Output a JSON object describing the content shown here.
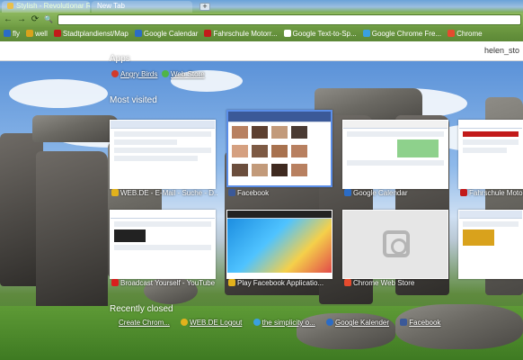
{
  "tabs": [
    {
      "label": "Stylish - Revolutionar Rate",
      "active": false
    },
    {
      "label": "New Tab",
      "active": true
    }
  ],
  "newtab_glyph": "+",
  "toolbar": {
    "back": "←",
    "forward": "→",
    "reload": "⟳",
    "search": "🔍"
  },
  "bookmarks": [
    {
      "label": "fly",
      "color": "#2b6cc6"
    },
    {
      "label": "well",
      "color": "#d9a21c"
    },
    {
      "label": "Stadtplandienst/Map",
      "color": "#c21a1a"
    },
    {
      "label": "Google Calendar",
      "color": "#2b6cc6"
    },
    {
      "label": "Fahrschule Motorr...",
      "color": "#c21a1a"
    },
    {
      "label": "Google Text-to-Sp...",
      "color": "#ffffff"
    },
    {
      "label": "Google Chrome Fre...",
      "color": "#3aa0e0"
    },
    {
      "label": "Chrome",
      "color": "#e54b2e"
    }
  ],
  "profile": {
    "name": "helen_sto"
  },
  "apps": {
    "title": "Apps",
    "items": [
      {
        "label": "Angry Birds",
        "color": "#d23a2a"
      },
      {
        "label": "Web Store",
        "color": "#4fb548"
      }
    ]
  },
  "most_visited": {
    "title": "Most visited",
    "tiles": [
      {
        "caption": "WEB.DE - E-Mail - Suche - D...",
        "icon": "#e2b21c"
      },
      {
        "caption": "Facebook",
        "icon": "#3b5998"
      },
      {
        "caption": "Google Calendar",
        "icon": "#2b6cc6"
      },
      {
        "caption": "Fahrschule Motorr...",
        "icon": "#c21a1a"
      },
      {
        "caption": "Broadcast Yourself - YouTube",
        "icon": "#d91d1d"
      },
      {
        "caption": "Play Facebook Applicatio...",
        "icon": "#e2b21c"
      },
      {
        "caption": "Chrome Web Store",
        "icon": "#e54b2e"
      },
      {
        "caption": "",
        "icon": ""
      }
    ]
  },
  "recently_closed": {
    "title": "Recently closed",
    "items": [
      {
        "label": "Create Chrom...",
        "color": ""
      },
      {
        "label": "WEB.DE Logout",
        "color": "#e2b21c"
      },
      {
        "label": "the simplicity o...",
        "color": "#3aa0e0"
      },
      {
        "label": "Google Kalender",
        "color": "#2b6cc6"
      },
      {
        "label": "Facebook",
        "color": "#3b5998"
      }
    ]
  }
}
